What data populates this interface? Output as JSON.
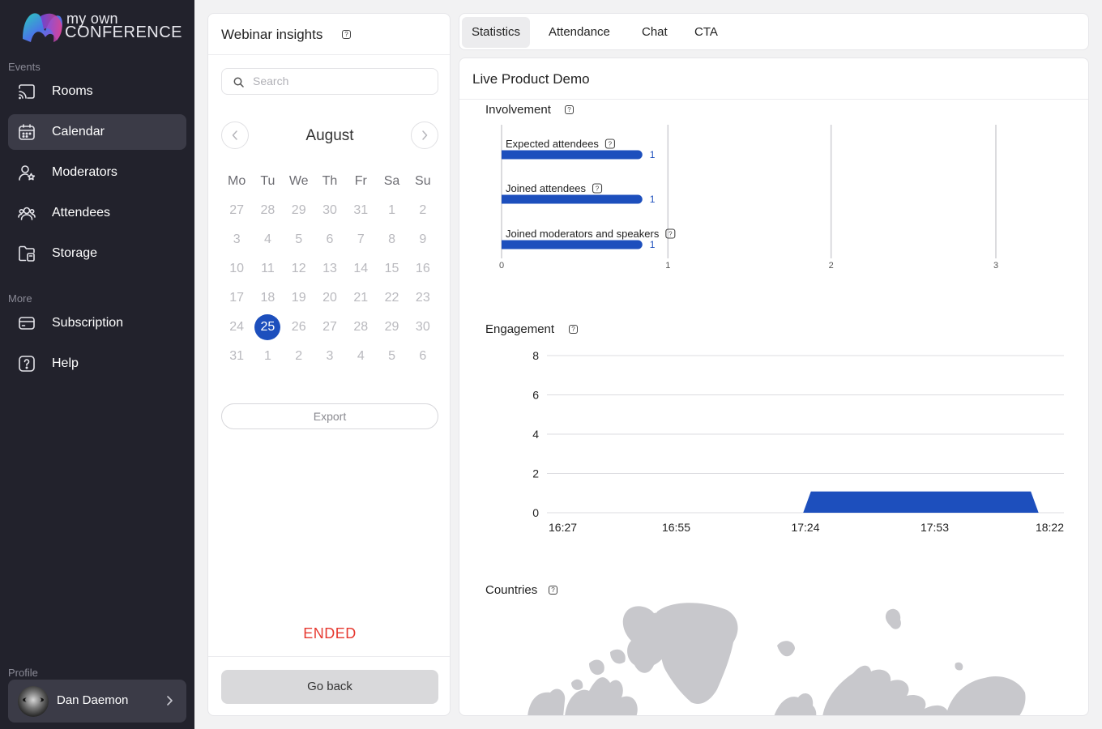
{
  "brand": {
    "line1": "my own",
    "line2": "CONFERENCE"
  },
  "sidebar": {
    "events_label": "Events",
    "more_label": "More",
    "profile_label": "Profile",
    "items": [
      {
        "label": "Rooms",
        "icon": "cast-icon"
      },
      {
        "label": "Calendar",
        "icon": "calendar-icon",
        "active": true
      },
      {
        "label": "Moderators",
        "icon": "moderator-icon"
      },
      {
        "label": "Attendees",
        "icon": "attendees-icon"
      },
      {
        "label": "Storage",
        "icon": "storage-icon"
      }
    ],
    "more_items": [
      {
        "label": "Subscription",
        "icon": "card-icon"
      },
      {
        "label": "Help",
        "icon": "help-icon"
      }
    ],
    "user_name": "Dan Daemon"
  },
  "insights": {
    "title": "Webinar insights",
    "search_placeholder": "Search",
    "month": "August",
    "weekdays": [
      "Mo",
      "Tu",
      "We",
      "Th",
      "Fr",
      "Sa",
      "Su"
    ],
    "weeks": [
      [
        "27",
        "28",
        "29",
        "30",
        "31",
        "1",
        "2"
      ],
      [
        "3",
        "4",
        "5",
        "6",
        "7",
        "8",
        "9"
      ],
      [
        "10",
        "11",
        "12",
        "13",
        "14",
        "15",
        "16"
      ],
      [
        "17",
        "18",
        "19",
        "20",
        "21",
        "22",
        "23"
      ],
      [
        "24",
        "25",
        "26",
        "27",
        "28",
        "29",
        "30"
      ],
      [
        "31",
        "1",
        "2",
        "3",
        "4",
        "5",
        "6"
      ]
    ],
    "selected_day": "25",
    "export_label": "Export",
    "status": "ENDED",
    "go_back_label": "Go back"
  },
  "tabs": [
    "Statistics",
    "Attendance",
    "Chat",
    "CTA"
  ],
  "active_tab": "Statistics",
  "main": {
    "title": "Live Product Demo",
    "involvement_title": "Involvement",
    "engagement_title": "Engagement",
    "countries_title": "Countries"
  },
  "colors": {
    "accent": "#1d4fbd",
    "ended": "#e6382f",
    "sidebar": "#22222c"
  },
  "chart_data": [
    {
      "type": "bar",
      "orientation": "horizontal",
      "title": "Involvement",
      "categories": [
        "Expected attendees",
        "Joined attendees",
        "Joined moderators and speakers"
      ],
      "values": [
        1,
        1,
        1
      ],
      "xlim": [
        0,
        3
      ],
      "x_ticks": [
        "0",
        "1",
        "2",
        "3"
      ],
      "grid": true
    },
    {
      "type": "area",
      "title": "Engagement",
      "x_ticks": [
        "16:27",
        "16:55",
        "17:24",
        "17:53",
        "18:22"
      ],
      "y_ticks": [
        "0",
        "2",
        "4",
        "6",
        "8"
      ],
      "ylim": [
        0,
        8
      ],
      "x": [
        "17:24",
        "17:25",
        "18:15",
        "18:16"
      ],
      "y": [
        0,
        1,
        1,
        0
      ],
      "grid": true
    }
  ]
}
